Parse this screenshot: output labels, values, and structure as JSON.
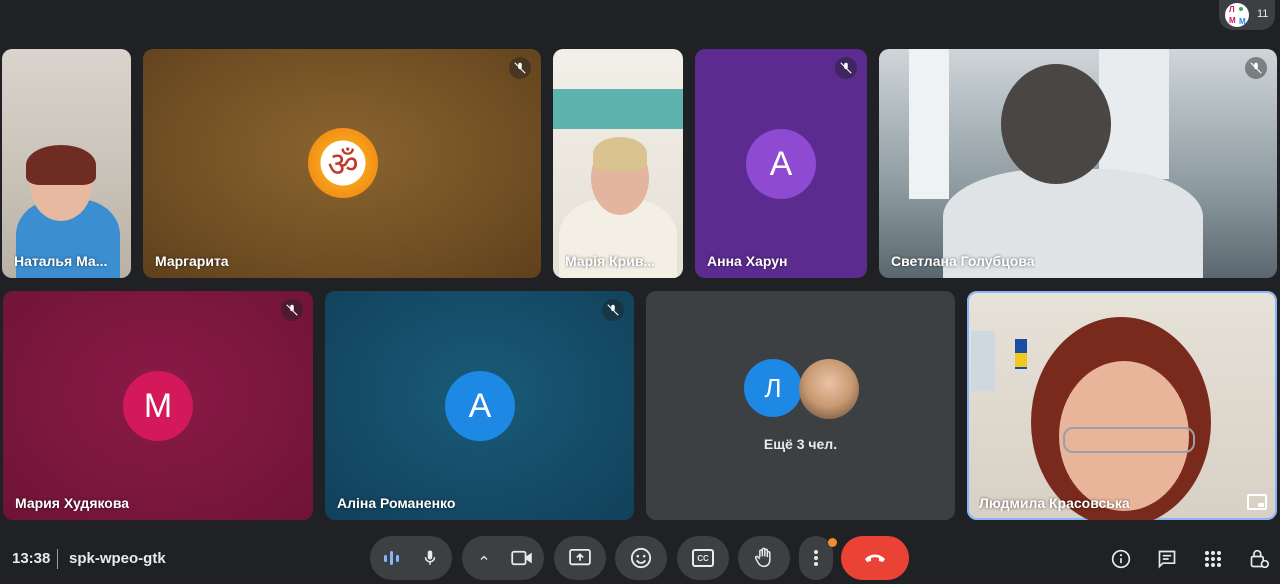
{
  "meeting": {
    "time": "13:38",
    "code": "spk-wpeo-gtk"
  },
  "participants_count": "11",
  "tiles": [
    {
      "name": "Наталья Ма...",
      "type": "video",
      "muted": false
    },
    {
      "name": "Маргарита",
      "type": "avatar-image",
      "avatar_symbol": "ॐ",
      "muted": true,
      "bg": "#7b5a2a"
    },
    {
      "name": "Марія Крив...",
      "type": "video",
      "muted": false
    },
    {
      "name": "Анна Харун",
      "type": "avatar-letter",
      "letter": "А",
      "avatar_color": "#8e4ad0",
      "bg": "#5b2b90",
      "muted": true
    },
    {
      "name": "Светлана Голубцова",
      "type": "video",
      "muted": true
    },
    {
      "name": "Мария Худякова",
      "type": "avatar-letter",
      "letter": "М",
      "avatar_color": "#d3195a",
      "bg": "#7a1a3c",
      "muted": true
    },
    {
      "name": "Аліна Романенко",
      "type": "avatar-letter",
      "letter": "А",
      "avatar_color": "#1e88e5",
      "bg": "#144a66",
      "muted": true
    },
    {
      "others_label": "Ещё 3 чел.",
      "type": "others",
      "letter": "Л",
      "avatar_color": "#1e88e5"
    },
    {
      "name": "Людмила Красовська",
      "type": "video",
      "muted": false,
      "self": true
    }
  ],
  "controls": {
    "mic": "mic-icon",
    "camera": "camera-icon",
    "present": "present-icon",
    "emoji": "emoji-icon",
    "captions": "CC",
    "hand": "raise-hand-icon",
    "more": "more-icon",
    "leave": "end-call-icon",
    "leave_color": "#ea4335"
  },
  "right_controls": {
    "info": "info-icon",
    "chat": "chat-icon",
    "activities": "apps-icon",
    "host": "lock-person-icon"
  }
}
